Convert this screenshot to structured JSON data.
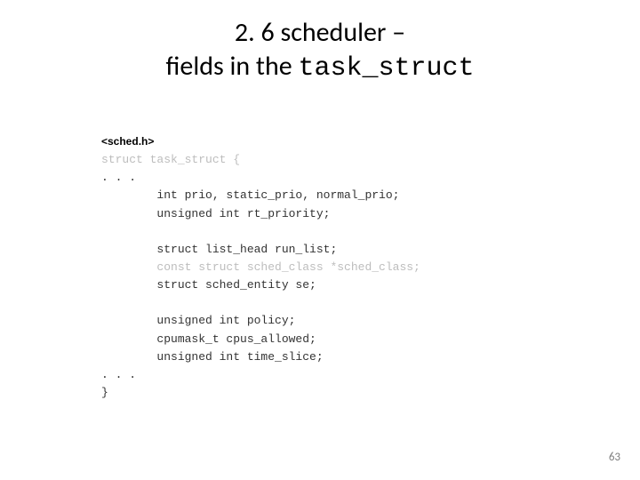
{
  "title": {
    "line1": "2. 6 scheduler –",
    "line2_prefix": "fields in the ",
    "line2_code": "task_struct"
  },
  "code": {
    "header": "<sched.h>",
    "l1": "struct task_struct {",
    "l2": ". . .",
    "l3": "        int prio, static_prio, normal_prio;",
    "l4": "        unsigned int rt_priority;",
    "l5": "",
    "l6": "        struct list_head run_list;",
    "l7": "        const struct sched_class *sched_class;",
    "l8": "        struct sched_entity se;",
    "l9": "",
    "l10": "        unsigned int policy;",
    "l11": "        cpumask_t cpus_allowed;",
    "l12": "        unsigned int time_slice;",
    "l13": ". . .",
    "l14": "}"
  },
  "page_number": "63"
}
